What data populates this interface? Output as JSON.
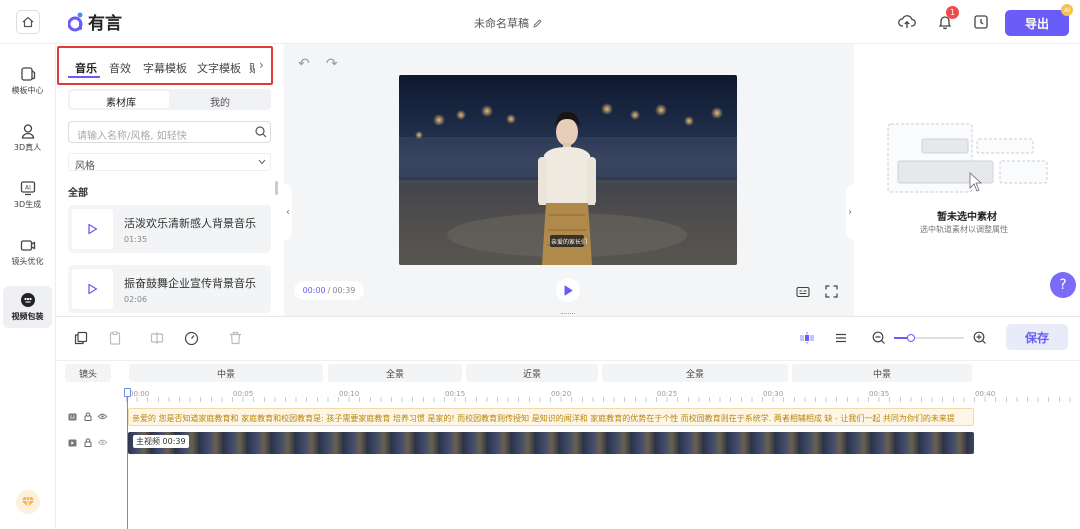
{
  "topbar": {
    "brand": "有言",
    "doc_title": "未命名草稿",
    "notification_count": "1",
    "export_label": "导出",
    "export_badge": "AI"
  },
  "left_nav": {
    "items": [
      {
        "label": "模板中心",
        "icon": "template-icon"
      },
      {
        "label": "3D真人",
        "icon": "avatar-icon"
      },
      {
        "label": "3D生成",
        "icon": "ai-generate-icon"
      },
      {
        "label": "镜头优化",
        "icon": "camera-icon"
      },
      {
        "label": "视频包装",
        "icon": "package-icon",
        "active": true
      }
    ]
  },
  "library": {
    "tabs": [
      "音乐",
      "音效",
      "字幕模板",
      "文字模板",
      "贴"
    ],
    "active_tab": "音乐",
    "segments": [
      "素材库",
      "我的"
    ],
    "search_placeholder": "请输入名称/风格, 如轻快",
    "style_filter": "风格",
    "section_title": "全部",
    "tracks": [
      {
        "title": "活泼欢乐清新感人背景音乐",
        "duration": "01:35"
      },
      {
        "title": "振奋鼓舞企业宣传背景音乐",
        "duration": "02:06"
      }
    ]
  },
  "preview": {
    "subtitle": "亲爱的家长们",
    "current_time": "00:00",
    "total_time": "00:39"
  },
  "properties": {
    "empty_title": "暂未选中素材",
    "empty_hint": "选中轨道素材以调整属性"
  },
  "timeline": {
    "save_label": "保存",
    "shot_label": "镜头",
    "shots": [
      "中景",
      "全景",
      "近景",
      "全景",
      "中景"
    ],
    "ticks": [
      "00:00",
      "00:05",
      "00:10",
      "00:15",
      "00:20",
      "00:25",
      "00:30",
      "00:35",
      "00:40"
    ],
    "caption_text": "亲爱的 您是否知道家庭教育和 家庭教育和校园教育是: 孩子需要家庭教育 培养习惯 是家的! 而校园教育则传授知 是知识的闻洋和 家庭教育的优势在于个性 而校园教育则在于系统学. 两者相辅相成 缺 - 让我们一起 共同为你们的未来提",
    "video_label": "主视频 00:39"
  },
  "colors": {
    "accent": "#6a5cf6",
    "highlight_box": "#e03a3a",
    "caption_track": "#fdf5e6"
  }
}
